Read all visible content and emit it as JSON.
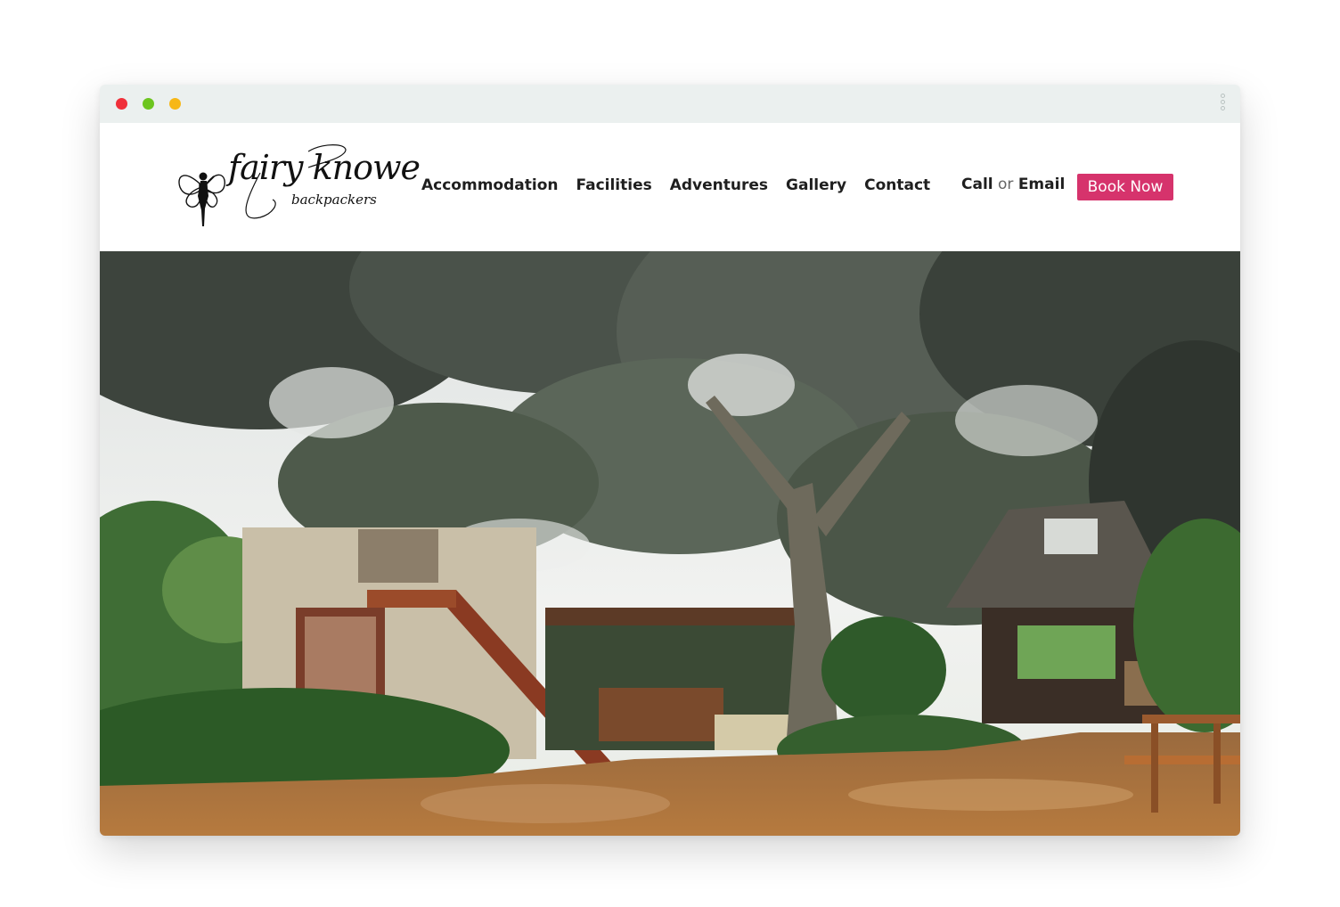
{
  "window": {
    "controls": [
      {
        "name": "close",
        "color": "#f0303a"
      },
      {
        "name": "minimize",
        "color": "#6cc51f"
      },
      {
        "name": "maximize",
        "color": "#f7b716"
      }
    ]
  },
  "brand": {
    "name": "fairy knowe",
    "subtitle": "backpackers",
    "logo_icon": "fairy-silhouette"
  },
  "nav": {
    "items": [
      {
        "label": "Accommodation"
      },
      {
        "label": "Facilities"
      },
      {
        "label": "Adventures"
      },
      {
        "label": "Gallery"
      },
      {
        "label": "Contact"
      }
    ]
  },
  "contact": {
    "call": "Call",
    "or": "or",
    "email": "Email"
  },
  "cta": {
    "label": "Book Now",
    "color": "#d6336c"
  },
  "hero": {
    "image": "Backpackers lodge under large trees with thatched building and outdoor seating"
  }
}
